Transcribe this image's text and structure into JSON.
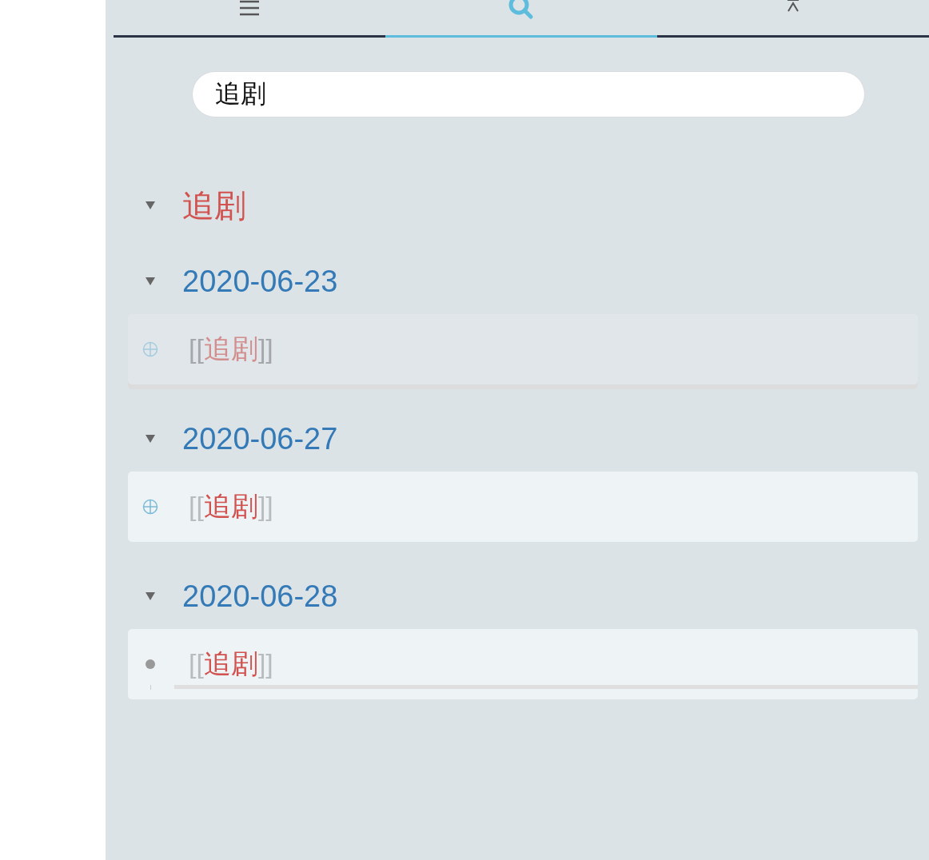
{
  "tabs": [
    {
      "kind": "menu",
      "selected": false
    },
    {
      "kind": "search",
      "selected": true
    },
    {
      "kind": "top",
      "selected": false
    }
  ],
  "search": {
    "value": "追剧"
  },
  "results": {
    "title": "追剧",
    "expanded": true,
    "groups": [
      {
        "date": "2020-06-23",
        "expanded": true,
        "blocks": [
          {
            "kind": "collapsed",
            "dimmed": true,
            "prefix": "[[",
            "link": "追剧",
            "suffix": "]]"
          }
        ]
      },
      {
        "date": "2020-06-27",
        "expanded": true,
        "blocks": [
          {
            "kind": "collapsed",
            "dimmed": false,
            "prefix": "[[",
            "link": "追剧",
            "suffix": "]]"
          }
        ]
      },
      {
        "date": "2020-06-28",
        "expanded": true,
        "blocks": [
          {
            "kind": "bullet",
            "dimmed": false,
            "prefix": "[[",
            "link": "追剧",
            "suffix": "]]"
          }
        ]
      }
    ]
  }
}
